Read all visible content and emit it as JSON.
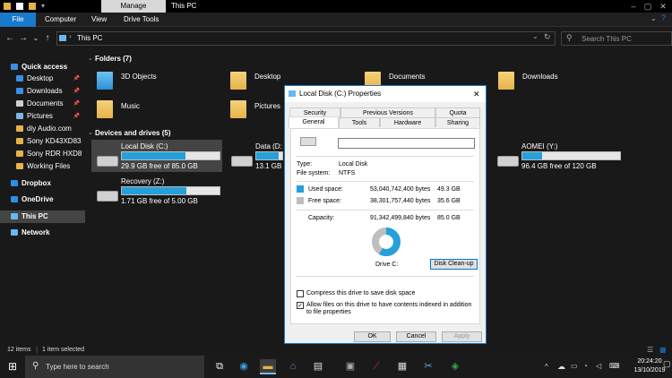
{
  "window": {
    "title": "This PC",
    "manage_tab": "Manage"
  },
  "ribbon": {
    "tabs": [
      "File",
      "Computer",
      "View",
      "Drive Tools"
    ]
  },
  "address": {
    "path": "This PC",
    "search_placeholder": "Search This PC"
  },
  "sidebar": {
    "items": [
      {
        "label": "Quick access",
        "icon": "star-icon",
        "color": "#3c8ee7",
        "pinned": false
      },
      {
        "label": "Desktop",
        "icon": "desktop-icon",
        "color": "#3c8ee7",
        "pinned": true
      },
      {
        "label": "Downloads",
        "icon": "download-icon",
        "color": "#3c8ee7",
        "pinned": true
      },
      {
        "label": "Documents",
        "icon": "documents-icon",
        "color": "#cfcfcf",
        "pinned": true
      },
      {
        "label": "Pictures",
        "icon": "pictures-icon",
        "color": "#7fb6e6",
        "pinned": true
      },
      {
        "label": "diy Audio.com",
        "icon": "folder-icon",
        "color": "#e6b24a",
        "pinned": false
      },
      {
        "label": "Sony KD43XD83",
        "icon": "folder-icon",
        "color": "#e6b24a",
        "pinned": false
      },
      {
        "label": "Sony RDR HXD8",
        "icon": "folder-icon",
        "color": "#e6b24a",
        "pinned": false
      },
      {
        "label": "Working Files",
        "icon": "folder-icon",
        "color": "#e6b24a",
        "pinned": false
      },
      {
        "label": "Dropbox",
        "icon": "dropbox-icon",
        "color": "#2e8ee6",
        "pinned": false
      },
      {
        "label": "OneDrive",
        "icon": "cloud-icon",
        "color": "#2e8ee6",
        "pinned": false
      },
      {
        "label": "This PC",
        "icon": "pc-icon",
        "color": "#6cb6f0",
        "pinned": false
      },
      {
        "label": "Network",
        "icon": "network-icon",
        "color": "#6cb6f0",
        "pinned": false
      }
    ]
  },
  "folders": {
    "heading": "Folders (7)",
    "items": [
      "3D Objects",
      "Desktop",
      "Documents",
      "Downloads",
      "Music",
      "Pictures"
    ]
  },
  "drives": {
    "heading": "Devices and drives (5)",
    "items": [
      {
        "name": "Local Disk (C:)",
        "free": "29.9 GB free of 85.0 GB",
        "used_fraction": 0.65
      },
      {
        "name": "Data (D:",
        "free": "13.1 GB",
        "used_fraction": 0.85
      },
      {
        "name": "AOMEI (Y:)",
        "free": "96.4 GB free of 120 GB",
        "used_fraction": 0.2
      },
      {
        "name": "Recovery (Z:)",
        "free": "1.71 GB free of 5.00 GB",
        "used_fraction": 0.66
      }
    ]
  },
  "status": {
    "items": "12 items",
    "selected": "1 item selected"
  },
  "taskbar": {
    "search_placeholder": "Type here to search",
    "time": "20:24:20",
    "date": "13/10/2019"
  },
  "dialog": {
    "title": "Local Disk (C:) Properties",
    "tabs_row1": [
      "Security",
      "Previous Versions",
      "Quota"
    ],
    "tabs_row2": [
      "General",
      "Tools",
      "Hardware",
      "Sharing"
    ],
    "type_label": "Type:",
    "type_value": "Local Disk",
    "fs_label": "File system:",
    "fs_value": "NTFS",
    "used_label": "Used space:",
    "used_bytes": "53,040,742,400 bytes",
    "used_gb": "49.3 GB",
    "free_label": "Free space:",
    "free_bytes": "38,301,757,440 bytes",
    "free_gb": "35.6 GB",
    "cap_label": "Capacity:",
    "cap_bytes": "91,342,499,840 bytes",
    "cap_gb": "85.0 GB",
    "used_fraction": 0.58,
    "drive_label": "Drive C:",
    "cleanup": "Disk Clean-up",
    "compress": "Compress this drive to save disk space",
    "index": "Allow files on this drive to have contents indexed in addition to file properties",
    "ok": "OK",
    "cancel": "Cancel",
    "apply": "Apply",
    "used_color": "#26a0da",
    "free_color": "#bebebe"
  }
}
